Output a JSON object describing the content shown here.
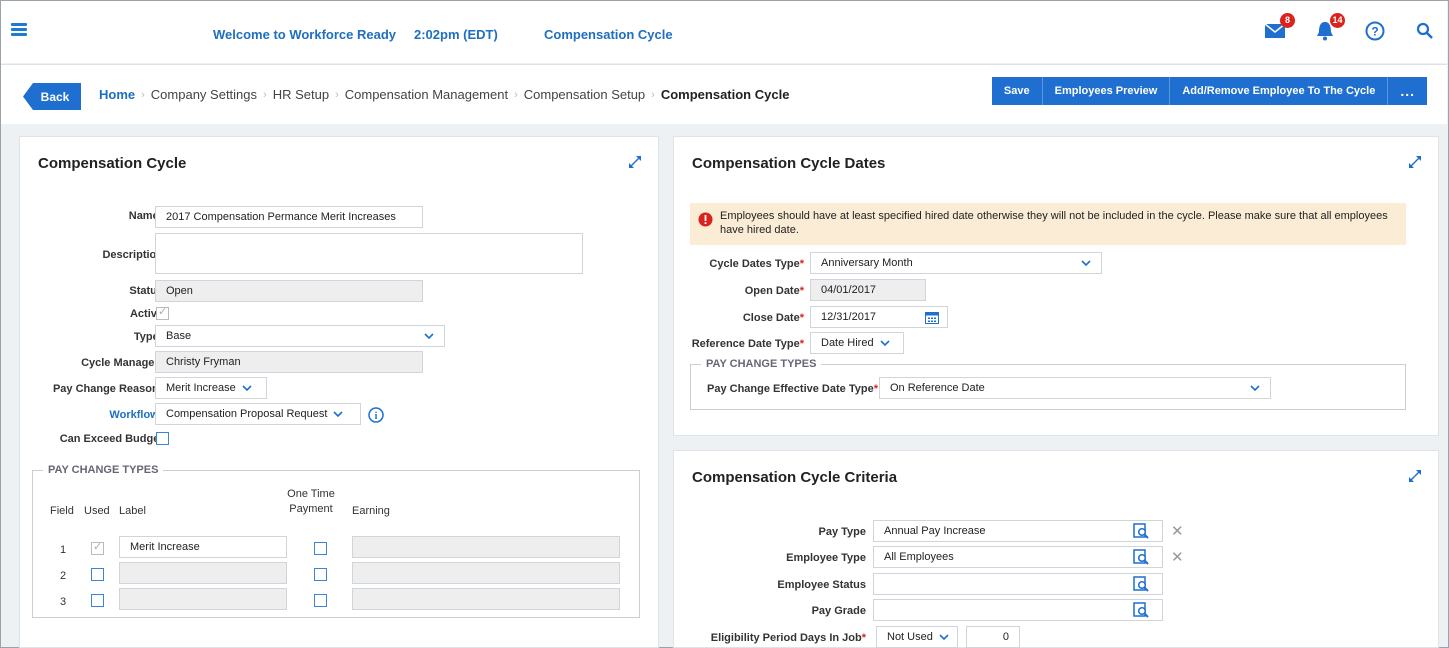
{
  "topbar": {
    "welcome": "Welcome to Workforce Ready",
    "time": "2:02pm (EDT)",
    "module": "Compensation Cycle",
    "mail_badge": "8",
    "bell_badge": "14"
  },
  "breadcrumb": {
    "back": "Back",
    "items": [
      "Home",
      "Company Settings",
      "HR Setup",
      "Compensation Management",
      "Compensation Setup",
      "Compensation Cycle"
    ]
  },
  "actions": {
    "save": "Save",
    "preview": "Employees Preview",
    "add_remove": "Add/Remove Employee To The Cycle",
    "more": "..."
  },
  "cycle": {
    "title": "Compensation Cycle",
    "name_label": "Name",
    "name_value": "2017 Compensation Permance Merit Increases",
    "description_label": "Description",
    "description_value": "",
    "status_label": "Status",
    "status_value": "Open",
    "active_label": "Active",
    "type_label": "Type",
    "type_value": "Base",
    "manager_label": "Cycle Manager",
    "manager_value": "Christy Fryman",
    "reason_label": "Pay Change Reason",
    "reason_value": "Merit Increase",
    "workflow_label": "Workflow",
    "workflow_value": "Compensation Proposal Request",
    "exceed_label": "Can Exceed Budget",
    "pct_legend": "PAY CHANGE TYPES",
    "col_field": "Field",
    "col_used": "Used",
    "col_label": "Label",
    "col_onetime": "One Time Payment",
    "col_earning": "Earning",
    "rows": [
      {
        "field": "1",
        "label": "Merit Increase"
      },
      {
        "field": "2",
        "label": ""
      },
      {
        "field": "3",
        "label": ""
      }
    ]
  },
  "dates": {
    "title": "Compensation Cycle Dates",
    "warning": "Employees should have at least specified hired date otherwise they will not be included in the cycle. Please make sure that all employees have hired date.",
    "type_label": "Cycle Dates Type",
    "type_value": "Anniversary Month",
    "open_label": "Open Date",
    "open_value": "04/01/2017",
    "close_label": "Close Date",
    "close_value": "12/31/2017",
    "ref_label": "Reference Date Type",
    "ref_value": "Date Hired",
    "pct_legend": "PAY CHANGE TYPES",
    "eff_label": "Pay Change Effective Date Type",
    "eff_value": "On Reference Date"
  },
  "criteria": {
    "title": "Compensation Cycle Criteria",
    "pay_type_label": "Pay Type",
    "pay_type_value": "Annual Pay Increase",
    "emp_type_label": "Employee Type",
    "emp_type_value": "All Employees",
    "emp_status_label": "Employee Status",
    "emp_status_value": "",
    "grade_label": "Pay Grade",
    "grade_value": "",
    "elig_label": "Eligibility Period Days In Job",
    "elig_value": "Not Used",
    "elig_days": "0"
  }
}
